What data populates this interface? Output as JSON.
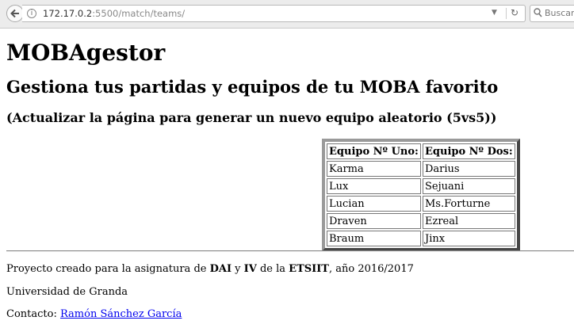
{
  "browser": {
    "url_host": "172.17.0.2",
    "url_path": ":5500/match/teams/",
    "search_placeholder": "Buscar",
    "icons": [
      "back-icon",
      "info-icon",
      "dropdown-icon",
      "reload-icon",
      "search-icon"
    ]
  },
  "page": {
    "title": "MOBAgestor",
    "subtitle": "Gestiona tus partidas y equipos de tu MOBA favorito",
    "note": "(Actualizar la página para generar un nuevo equipo aleatorio (5vs5))",
    "table": {
      "headers": [
        "Equipo Nº Uno:",
        "Equipo Nº Dos:"
      ],
      "rows": [
        [
          "Karma",
          "Darius"
        ],
        [
          "Lux",
          "Sejuani"
        ],
        [
          "Lucian",
          "Ms.Forturne"
        ],
        [
          "Draven",
          "Ezreal"
        ],
        [
          "Braum",
          "Jinx"
        ]
      ]
    },
    "footer": {
      "line1_pre": "Proyecto creado para la asignatura de ",
      "line1_b1": "DAI",
      "line1_mid1": " y ",
      "line1_b2": "IV",
      "line1_mid2": " de la ",
      "line1_b3": "ETSIIT",
      "line1_post": ", año 2016/2017",
      "line2": "Universidad de Granda",
      "line3_pre": "Contacto: ",
      "contact_link": "Ramón Sánchez García"
    }
  }
}
